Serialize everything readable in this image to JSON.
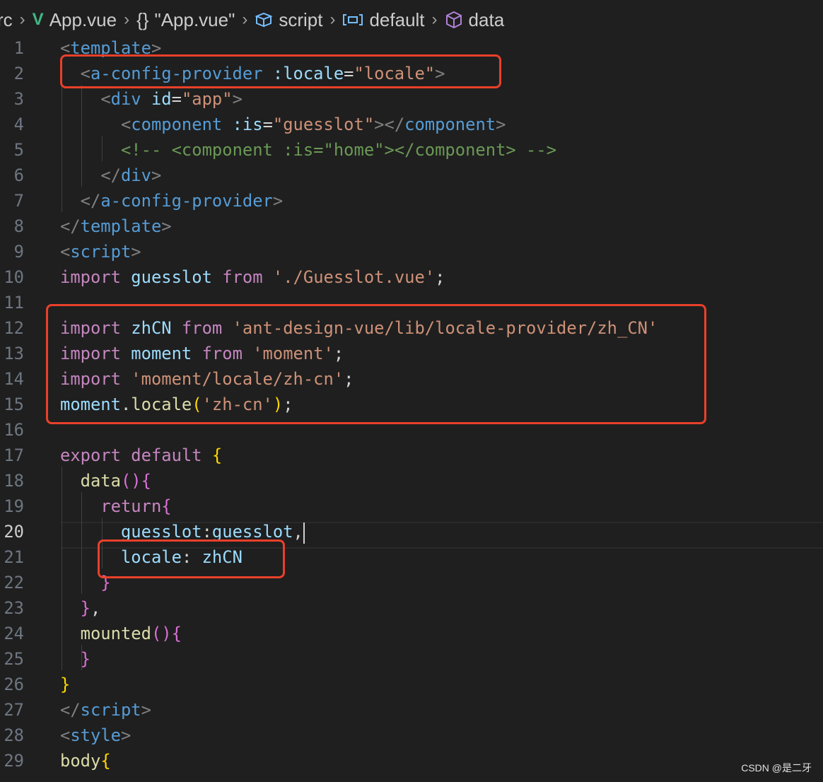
{
  "breadcrumb": {
    "folder": "rc",
    "file": "App.vue",
    "scope_file": "\"App.vue\"",
    "scope_script": "script",
    "scope_default": "default",
    "scope_data": "data"
  },
  "editor": {
    "active_line": 20,
    "lines": [
      {
        "n": "1",
        "tokens": [
          [
            "t-punc",
            "<"
          ],
          [
            "t-tag",
            "template"
          ],
          [
            "t-punc",
            ">"
          ]
        ]
      },
      {
        "n": "2",
        "tokens": [
          [
            "t-plain",
            "  "
          ],
          [
            "t-punc",
            "<"
          ],
          [
            "t-tag",
            "a-config-provider"
          ],
          [
            "t-plain",
            " "
          ],
          [
            "t-attr",
            ":locale"
          ],
          [
            "t-plain",
            "="
          ],
          [
            "t-str",
            "\"locale\""
          ],
          [
            "t-punc",
            ">"
          ]
        ]
      },
      {
        "n": "3",
        "tokens": [
          [
            "t-plain",
            "    "
          ],
          [
            "t-punc",
            "<"
          ],
          [
            "t-tag",
            "div"
          ],
          [
            "t-plain",
            " "
          ],
          [
            "t-attr",
            "id"
          ],
          [
            "t-plain",
            "="
          ],
          [
            "t-str",
            "\"app\""
          ],
          [
            "t-punc",
            ">"
          ]
        ]
      },
      {
        "n": "4",
        "tokens": [
          [
            "t-plain",
            "      "
          ],
          [
            "t-punc",
            "<"
          ],
          [
            "t-tag",
            "component"
          ],
          [
            "t-plain",
            " "
          ],
          [
            "t-attr",
            ":is"
          ],
          [
            "t-plain",
            "="
          ],
          [
            "t-str",
            "\"guesslot\""
          ],
          [
            "t-punc",
            "></"
          ],
          [
            "t-tag",
            "component"
          ],
          [
            "t-punc",
            ">"
          ]
        ]
      },
      {
        "n": "5",
        "tokens": [
          [
            "t-plain",
            "      "
          ],
          [
            "t-cmt",
            "<!-- <component :is=\"home\"></component> -->"
          ]
        ]
      },
      {
        "n": "6",
        "tokens": [
          [
            "t-plain",
            "    "
          ],
          [
            "t-punc",
            "</"
          ],
          [
            "t-tag",
            "div"
          ],
          [
            "t-punc",
            ">"
          ]
        ]
      },
      {
        "n": "7",
        "tokens": [
          [
            "t-plain",
            "  "
          ],
          [
            "t-punc",
            "</"
          ],
          [
            "t-tag",
            "a-config-provider"
          ],
          [
            "t-punc",
            ">"
          ]
        ]
      },
      {
        "n": "8",
        "tokens": [
          [
            "t-punc",
            "</"
          ],
          [
            "t-tag",
            "template"
          ],
          [
            "t-punc",
            ">"
          ]
        ]
      },
      {
        "n": "9",
        "tokens": [
          [
            "t-punc",
            "<"
          ],
          [
            "t-tag",
            "script"
          ],
          [
            "t-punc",
            ">"
          ]
        ]
      },
      {
        "n": "10",
        "tokens": [
          [
            "t-kw",
            "import"
          ],
          [
            "t-plain",
            " "
          ],
          [
            "t-var",
            "guesslot"
          ],
          [
            "t-plain",
            " "
          ],
          [
            "t-kw",
            "from"
          ],
          [
            "t-plain",
            " "
          ],
          [
            "t-str",
            "'./Guesslot.vue'"
          ],
          [
            "t-plain",
            ";"
          ]
        ]
      },
      {
        "n": "11",
        "tokens": []
      },
      {
        "n": "12",
        "tokens": [
          [
            "t-kw",
            "import"
          ],
          [
            "t-plain",
            " "
          ],
          [
            "t-var",
            "zhCN"
          ],
          [
            "t-plain",
            " "
          ],
          [
            "t-kw",
            "from"
          ],
          [
            "t-plain",
            " "
          ],
          [
            "t-str",
            "'ant-design-vue/lib/locale-provider/zh_CN'"
          ]
        ]
      },
      {
        "n": "13",
        "tokens": [
          [
            "t-kw",
            "import"
          ],
          [
            "t-plain",
            " "
          ],
          [
            "t-var",
            "moment"
          ],
          [
            "t-plain",
            " "
          ],
          [
            "t-kw",
            "from"
          ],
          [
            "t-plain",
            " "
          ],
          [
            "t-str",
            "'moment'"
          ],
          [
            "t-plain",
            ";"
          ]
        ]
      },
      {
        "n": "14",
        "tokens": [
          [
            "t-kw",
            "import"
          ],
          [
            "t-plain",
            " "
          ],
          [
            "t-str",
            "'moment/locale/zh-cn'"
          ],
          [
            "t-plain",
            ";"
          ]
        ]
      },
      {
        "n": "15",
        "tokens": [
          [
            "t-var",
            "moment"
          ],
          [
            "t-plain",
            "."
          ],
          [
            "t-fn",
            "locale"
          ],
          [
            "t-brace",
            "("
          ],
          [
            "t-str",
            "'zh-cn'"
          ],
          [
            "t-brace",
            ")"
          ],
          [
            "t-plain",
            ";"
          ]
        ]
      },
      {
        "n": "16",
        "tokens": []
      },
      {
        "n": "17",
        "tokens": [
          [
            "t-kw",
            "export"
          ],
          [
            "t-plain",
            " "
          ],
          [
            "t-kw",
            "default"
          ],
          [
            "t-plain",
            " "
          ],
          [
            "t-brace",
            "{"
          ]
        ]
      },
      {
        "n": "18",
        "tokens": [
          [
            "t-plain",
            "  "
          ],
          [
            "t-fn",
            "data"
          ],
          [
            "t-brace2",
            "(){"
          ]
        ]
      },
      {
        "n": "19",
        "tokens": [
          [
            "t-plain",
            "    "
          ],
          [
            "t-kw",
            "return"
          ],
          [
            "t-brace2",
            "{"
          ]
        ]
      },
      {
        "n": "20",
        "tokens": [
          [
            "t-plain",
            "      "
          ],
          [
            "t-var",
            "guesslot"
          ],
          [
            "t-plain",
            ":"
          ],
          [
            "t-var",
            "guesslot"
          ],
          [
            "t-plain",
            ","
          ]
        ]
      },
      {
        "n": "21",
        "tokens": [
          [
            "t-plain",
            "      "
          ],
          [
            "t-var",
            "locale"
          ],
          [
            "t-plain",
            ": "
          ],
          [
            "t-var",
            "zhCN"
          ]
        ]
      },
      {
        "n": "22",
        "tokens": [
          [
            "t-plain",
            "    "
          ],
          [
            "t-brace2",
            "}"
          ]
        ]
      },
      {
        "n": "23",
        "tokens": [
          [
            "t-plain",
            "  "
          ],
          [
            "t-brace2",
            "}"
          ],
          [
            "t-plain",
            ","
          ]
        ]
      },
      {
        "n": "24",
        "tokens": [
          [
            "t-plain",
            "  "
          ],
          [
            "t-fn",
            "mounted"
          ],
          [
            "t-brace2",
            "(){"
          ]
        ]
      },
      {
        "n": "25",
        "tokens": [
          [
            "t-plain",
            "  "
          ],
          [
            "t-brace2",
            "}"
          ]
        ]
      },
      {
        "n": "26",
        "tokens": [
          [
            "t-brace",
            "}"
          ]
        ]
      },
      {
        "n": "27",
        "tokens": [
          [
            "t-punc",
            "</"
          ],
          [
            "t-tag",
            "script"
          ],
          [
            "t-punc",
            ">"
          ]
        ]
      },
      {
        "n": "28",
        "tokens": [
          [
            "t-punc",
            "<"
          ],
          [
            "t-tag",
            "style"
          ],
          [
            "t-punc",
            ">"
          ]
        ]
      },
      {
        "n": "29",
        "tokens": [
          [
            "t-fn",
            "body"
          ],
          [
            "t-brace",
            "{"
          ]
        ]
      }
    ]
  },
  "watermark": "CSDN @是二牙"
}
